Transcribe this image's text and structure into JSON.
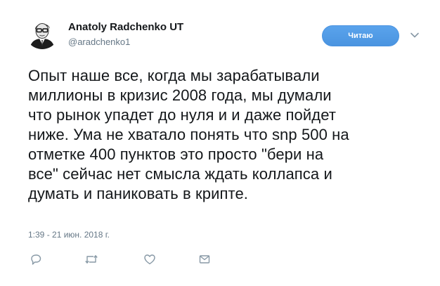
{
  "tweet": {
    "author": {
      "display_name": "Anatoly Radchenko UT",
      "screen_name": "@aradchenko1"
    },
    "follow_button_label": "Читаю",
    "text": "Опыт наше все, когда мы зарабатывали\nмиллионы в кризис 2008 года, мы думали\nчто рынок упадет до нуля и и даже пойдет\nниже. Ума не хватало понять что snp 500 на\nотметке 400 пунктов это просто \"бери на\nвсе\" сейчас нет смысла ждать коллапса и\nдумать и паниковать в крипте.",
    "timestamp": "1:39 - 21 июн. 2018 г.",
    "actions": [
      "reply-icon",
      "retweet-icon",
      "like-icon",
      "direct-message-icon"
    ]
  },
  "colors": {
    "accent": "#4a94e0",
    "secondary_text": "#657786",
    "primary_text": "#14171a"
  }
}
